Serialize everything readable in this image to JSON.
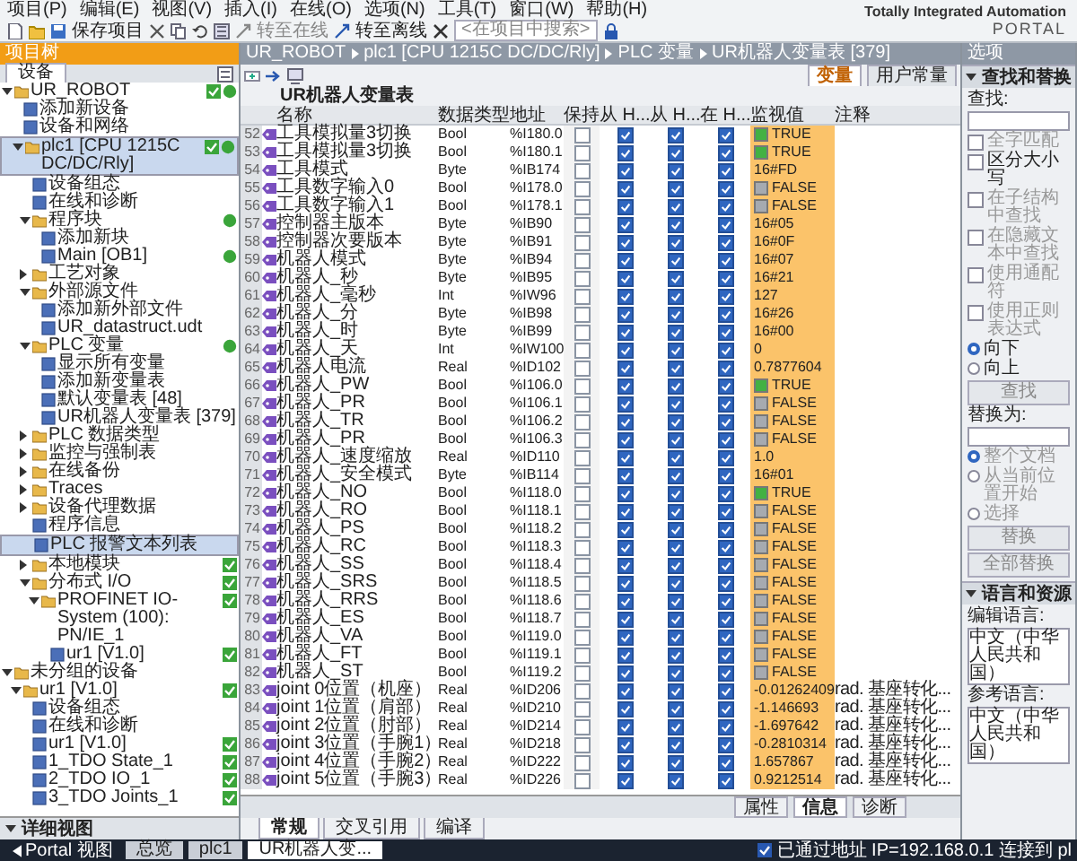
{
  "menu": [
    "项目(P)",
    "编辑(E)",
    "视图(V)",
    "插入(I)",
    "在线(O)",
    "选项(N)",
    "工具(T)",
    "窗口(W)",
    "帮助(H)"
  ],
  "toolbar": {
    "save": "保存项目",
    "online": "转至在线",
    "offline": "转至离线",
    "search_placeholder": "<在项目中搜索>"
  },
  "brand": {
    "line1": "Totally Integrated Automation",
    "line2": "PORTAL"
  },
  "project_tree": {
    "title": "项目树",
    "tab": "设备",
    "detail_title": "详细视图",
    "items": [
      {
        "label": "UR_ROBOT",
        "expanded": true,
        "selected": false,
        "ok": true,
        "online": true,
        "children": [
          {
            "label": "添加新设备",
            "selected": false
          },
          {
            "label": "设备和网络",
            "selected": false
          },
          {
            "label": "plc1 [CPU 1215C DC/DC/Rly]",
            "expanded": true,
            "selected": true,
            "ok": true,
            "online": true,
            "children": [
              {
                "label": "设备组态",
                "selected": false
              },
              {
                "label": "在线和诊断",
                "selected": false
              },
              {
                "label": "程序块",
                "expanded": true,
                "selected": false,
                "online": true,
                "children": [
                  {
                    "label": "添加新块",
                    "selected": false
                  },
                  {
                    "label": "Main [OB1]",
                    "selected": false,
                    "online": true
                  }
                ]
              },
              {
                "label": "工艺对象",
                "expanded": false,
                "selected": false
              },
              {
                "label": "外部源文件",
                "expanded": true,
                "selected": false,
                "children": [
                  {
                    "label": "添加新外部文件",
                    "selected": false
                  },
                  {
                    "label": "UR_datastruct.udt",
                    "selected": false
                  }
                ]
              },
              {
                "label": "PLC 变量",
                "expanded": true,
                "selected": false,
                "online": true,
                "children": [
                  {
                    "label": "显示所有变量",
                    "selected": false
                  },
                  {
                    "label": "添加新变量表",
                    "selected": false
                  },
                  {
                    "label": "默认变量表 [48]",
                    "selected": false
                  },
                  {
                    "label": "UR机器人变量表 [379]",
                    "selected": false
                  }
                ]
              },
              {
                "label": "PLC 数据类型",
                "expanded": false,
                "selected": false
              },
              {
                "label": "监控与强制表",
                "expanded": false,
                "selected": false
              },
              {
                "label": "在线备份",
                "expanded": false,
                "selected": false
              },
              {
                "label": "Traces",
                "expanded": false,
                "selected": false
              },
              {
                "label": "设备代理数据",
                "expanded": false,
                "selected": false
              },
              {
                "label": "程序信息",
                "selected": false
              },
              {
                "label": "PLC 报警文本列表",
                "selected": true
              },
              {
                "label": "本地模块",
                "expanded": false,
                "selected": false,
                "ok": true
              },
              {
                "label": "分布式 I/O",
                "expanded": true,
                "selected": false,
                "ok": true,
                "children": [
                  {
                    "label": "PROFINET IO-System (100): PN/IE_1",
                    "expanded": true,
                    "selected": false,
                    "ok": true,
                    "children": [
                      {
                        "label": "ur1 [V1.0]",
                        "selected": false,
                        "ok": true
                      }
                    ]
                  }
                ]
              }
            ]
          }
        ]
      },
      {
        "label": "未分组的设备",
        "expanded": true,
        "selected": false,
        "children": [
          {
            "label": "ur1 [V1.0]",
            "expanded": true,
            "selected": false,
            "ok": true,
            "children": [
              {
                "label": "设备组态",
                "selected": false
              },
              {
                "label": "在线和诊断",
                "selected": false
              },
              {
                "label": "ur1 [V1.0]",
                "selected": false,
                "ok": true
              },
              {
                "label": "1_TDO State_1",
                "selected": false,
                "ok": true
              },
              {
                "label": "2_TDO IO_1",
                "selected": false,
                "ok": true
              },
              {
                "label": "3_TDO Joints_1",
                "selected": false,
                "ok": true
              }
            ]
          }
        ]
      }
    ]
  },
  "editor": {
    "breadcrumb": [
      "UR_ROBOT",
      "plc1 [CPU 1215C DC/DC/Rly]",
      "PLC 变量",
      "UR机器人变量表 [379]"
    ],
    "tabs": [
      {
        "label": "变量",
        "selected": true
      },
      {
        "label": "用户常量",
        "selected": false
      }
    ],
    "table_title": "UR机器人变量表",
    "columns": [
      "名称",
      "数据类型",
      "地址",
      "保持",
      "从 H...",
      "从 H...",
      "在 H...",
      "监视值",
      "注释"
    ],
    "rows": [
      {
        "no": "52",
        "name": "工具模拟量3切换",
        "type": "Bool",
        "address": "%I180.0",
        "retain": false,
        "h1": true,
        "h2": true,
        "h3": true,
        "lamp": true,
        "value": "TRUE"
      },
      {
        "no": "53",
        "name": "工具模拟量3切换",
        "type": "Bool",
        "address": "%I180.1",
        "retain": false,
        "h1": true,
        "h2": true,
        "h3": true,
        "lamp": true,
        "value": "TRUE"
      },
      {
        "no": "54",
        "name": "工具模式",
        "type": "Byte",
        "address": "%IB174",
        "retain": false,
        "h1": true,
        "h2": true,
        "h3": true,
        "value": "16#FD"
      },
      {
        "no": "55",
        "name": "工具数字输入0",
        "type": "Bool",
        "address": "%I178.0",
        "retain": false,
        "h1": true,
        "h2": true,
        "h3": true,
        "lamp": false,
        "value": "FALSE"
      },
      {
        "no": "56",
        "name": "工具数字输入1",
        "type": "Bool",
        "address": "%I178.1",
        "retain": false,
        "h1": true,
        "h2": true,
        "h3": true,
        "lamp": false,
        "value": "FALSE"
      },
      {
        "no": "57",
        "name": "控制器主版本",
        "type": "Byte",
        "address": "%IB90",
        "retain": false,
        "h1": true,
        "h2": true,
        "h3": true,
        "value": "16#05"
      },
      {
        "no": "58",
        "name": "控制器次要版本",
        "type": "Byte",
        "address": "%IB91",
        "retain": false,
        "h1": true,
        "h2": true,
        "h3": true,
        "value": "16#0F"
      },
      {
        "no": "59",
        "name": "机器人模式",
        "type": "Byte",
        "address": "%IB94",
        "retain": false,
        "h1": true,
        "h2": true,
        "h3": true,
        "value": "16#07"
      },
      {
        "no": "60",
        "name": "机器人_秒",
        "type": "Byte",
        "address": "%IB95",
        "retain": false,
        "h1": true,
        "h2": true,
        "h3": true,
        "value": "16#21"
      },
      {
        "no": "61",
        "name": "机器人_毫秒",
        "type": "Int",
        "address": "%IW96",
        "retain": false,
        "h1": true,
        "h2": true,
        "h3": true,
        "value": "127"
      },
      {
        "no": "62",
        "name": "机器人_分",
        "type": "Byte",
        "address": "%IB98",
        "retain": false,
        "h1": true,
        "h2": true,
        "h3": true,
        "value": "16#26"
      },
      {
        "no": "63",
        "name": "机器人_时",
        "type": "Byte",
        "address": "%IB99",
        "retain": false,
        "h1": true,
        "h2": true,
        "h3": true,
        "value": "16#00"
      },
      {
        "no": "64",
        "name": "机器人_天",
        "type": "Int",
        "address": "%IW100",
        "retain": false,
        "h1": true,
        "h2": true,
        "h3": true,
        "value": "0"
      },
      {
        "no": "65",
        "name": "机器人电流",
        "type": "Real",
        "address": "%ID102",
        "retain": false,
        "h1": true,
        "h2": true,
        "h3": true,
        "value": "0.7877604"
      },
      {
        "no": "66",
        "name": "机器人_PW",
        "type": "Bool",
        "address": "%I106.0",
        "retain": false,
        "h1": true,
        "h2": true,
        "h3": true,
        "lamp": true,
        "value": "TRUE"
      },
      {
        "no": "67",
        "name": "机器人_PR",
        "type": "Bool",
        "address": "%I106.1",
        "retain": false,
        "h1": true,
        "h2": true,
        "h3": true,
        "lamp": false,
        "value": "FALSE"
      },
      {
        "no": "68",
        "name": "机器人_TR",
        "type": "Bool",
        "address": "%I106.2",
        "retain": false,
        "h1": true,
        "h2": true,
        "h3": true,
        "lamp": false,
        "value": "FALSE"
      },
      {
        "no": "69",
        "name": "机器人_PR",
        "type": "Bool",
        "address": "%I106.3",
        "retain": false,
        "h1": true,
        "h2": true,
        "h3": true,
        "lamp": false,
        "value": "FALSE"
      },
      {
        "no": "70",
        "name": "机器人_速度缩放",
        "type": "Real",
        "address": "%ID110",
        "retain": false,
        "h1": true,
        "h2": true,
        "h3": true,
        "value": "1.0"
      },
      {
        "no": "71",
        "name": "机器人_安全模式",
        "type": "Byte",
        "address": "%IB114",
        "retain": false,
        "h1": true,
        "h2": true,
        "h3": true,
        "value": "16#01"
      },
      {
        "no": "72",
        "name": "机器人_NO",
        "type": "Bool",
        "address": "%I118.0",
        "retain": false,
        "h1": true,
        "h2": true,
        "h3": true,
        "lamp": true,
        "value": "TRUE"
      },
      {
        "no": "73",
        "name": "机器人_RO",
        "type": "Bool",
        "address": "%I118.1",
        "retain": false,
        "h1": true,
        "h2": true,
        "h3": true,
        "lamp": false,
        "value": "FALSE"
      },
      {
        "no": "74",
        "name": "机器人_PS",
        "type": "Bool",
        "address": "%I118.2",
        "retain": false,
        "h1": true,
        "h2": true,
        "h3": true,
        "lamp": false,
        "value": "FALSE"
      },
      {
        "no": "75",
        "name": "机器人_RC",
        "type": "Bool",
        "address": "%I118.3",
        "retain": false,
        "h1": true,
        "h2": true,
        "h3": true,
        "lamp": false,
        "value": "FALSE"
      },
      {
        "no": "76",
        "name": "机器人_SS",
        "type": "Bool",
        "address": "%I118.4",
        "retain": false,
        "h1": true,
        "h2": true,
        "h3": true,
        "lamp": false,
        "value": "FALSE"
      },
      {
        "no": "77",
        "name": "机器人_SRS",
        "type": "Bool",
        "address": "%I118.5",
        "retain": false,
        "h1": true,
        "h2": true,
        "h3": true,
        "lamp": false,
        "value": "FALSE"
      },
      {
        "no": "78",
        "name": "机器人_RRS",
        "type": "Bool",
        "address": "%I118.6",
        "retain": false,
        "h1": true,
        "h2": true,
        "h3": true,
        "lamp": false,
        "value": "FALSE"
      },
      {
        "no": "79",
        "name": "机器人_ES",
        "type": "Bool",
        "address": "%I118.7",
        "retain": false,
        "h1": true,
        "h2": true,
        "h3": true,
        "lamp": false,
        "value": "FALSE"
      },
      {
        "no": "80",
        "name": "机器人_VA",
        "type": "Bool",
        "address": "%I119.0",
        "retain": false,
        "h1": true,
        "h2": true,
        "h3": true,
        "lamp": false,
        "value": "FALSE"
      },
      {
        "no": "81",
        "name": "机器人_FT",
        "type": "Bool",
        "address": "%I119.1",
        "retain": false,
        "h1": true,
        "h2": true,
        "h3": true,
        "lamp": false,
        "value": "FALSE"
      },
      {
        "no": "82",
        "name": "机器人_ST",
        "type": "Bool",
        "address": "%I119.2",
        "retain": false,
        "h1": true,
        "h2": true,
        "h3": true,
        "lamp": false,
        "value": "FALSE"
      },
      {
        "no": "83",
        "name": "joint 0位置（机座）",
        "type": "Real",
        "address": "%ID206",
        "retain": false,
        "h1": true,
        "h2": true,
        "h3": true,
        "value": "-0.01262409",
        "comment": "rad. 基座转化..."
      },
      {
        "no": "84",
        "name": "joint 1位置（肩部）",
        "type": "Real",
        "address": "%ID210",
        "retain": false,
        "h1": true,
        "h2": true,
        "h3": true,
        "value": "-1.146693",
        "comment": "rad. 基座转化..."
      },
      {
        "no": "85",
        "name": "joint 2位置（肘部）",
        "type": "Real",
        "address": "%ID214",
        "retain": false,
        "h1": true,
        "h2": true,
        "h3": true,
        "value": "-1.697642",
        "comment": "rad. 基座转化..."
      },
      {
        "no": "86",
        "name": "joint 3位置（手腕1）",
        "type": "Real",
        "address": "%ID218",
        "retain": false,
        "h1": true,
        "h2": true,
        "h3": true,
        "value": "-0.2810314",
        "comment": "rad. 基座转化..."
      },
      {
        "no": "87",
        "name": "joint 4位置（手腕2）",
        "type": "Real",
        "address": "%ID222",
        "retain": false,
        "h1": true,
        "h2": true,
        "h3": true,
        "value": "1.657867",
        "comment": "rad. 基座转化..."
      },
      {
        "no": "88",
        "name": "joint 5位置（手腕3）",
        "type": "Real",
        "address": "%ID226",
        "retain": false,
        "h1": true,
        "h2": true,
        "h3": true,
        "value": "0.9212514",
        "comment": "rad. 基座转化..."
      }
    ]
  },
  "inspector_tabs": [
    {
      "label": "属性",
      "selected": false
    },
    {
      "label": "信息",
      "selected": true
    },
    {
      "label": "诊断",
      "selected": false
    }
  ],
  "bottom_tabs": [
    {
      "label": "常规",
      "selected": true
    },
    {
      "label": "交叉引用",
      "selected": false
    },
    {
      "label": "编译",
      "selected": false
    }
  ],
  "options_panel": {
    "title": "选项",
    "find_section": "查找和替换",
    "find_label": "查找:",
    "options": [
      {
        "label": "全字匹配",
        "checked": false,
        "disabled": true
      },
      {
        "label": "区分大小写",
        "checked": false,
        "disabled": false
      },
      {
        "label": "在子结构中查找",
        "checked": false,
        "disabled": true
      },
      {
        "label": "在隐藏文本中查找",
        "checked": false,
        "disabled": true
      },
      {
        "label": "使用通配符",
        "checked": false,
        "disabled": true
      },
      {
        "label": "使用正则表达式",
        "checked": false,
        "disabled": true
      }
    ],
    "direction": [
      {
        "label": "向下",
        "selected": true
      },
      {
        "label": "向上",
        "selected": false
      }
    ],
    "find_button": "查找",
    "replace_label": "替换为:",
    "scope": [
      {
        "label": "整个文档",
        "selected": true
      },
      {
        "label": "从当前位置开始",
        "selected": false
      },
      {
        "label": "选择",
        "selected": false
      }
    ],
    "buttons": [
      "替换",
      "全部替换"
    ],
    "lang_section": "语言和资源",
    "edit_lang_label": "编辑语言:",
    "edit_lang": "中文（中华人民共和国）",
    "ref_lang_label": "参考语言:",
    "ref_lang": "中文（中华人民共和国）"
  },
  "taskbar": {
    "portal": "Portal 视图",
    "tasks": [
      {
        "label": "总览",
        "selected": false
      },
      {
        "label": "plc1",
        "selected": false
      },
      {
        "label": "UR机器人变...",
        "selected": true
      }
    ],
    "status": "已通过地址 IP=192.168.0.1 连接到 pl"
  }
}
